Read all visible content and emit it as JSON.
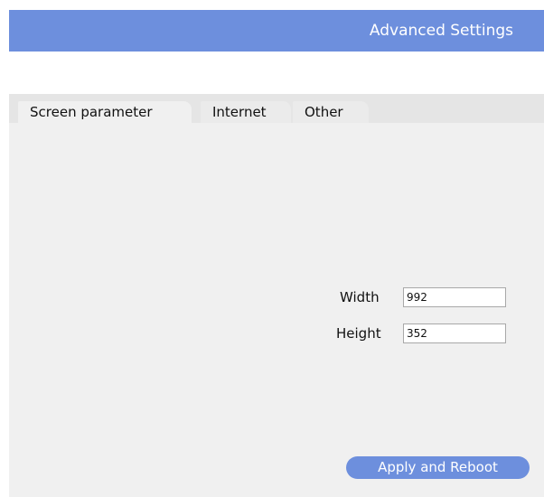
{
  "header": {
    "title": "Advanced Settings"
  },
  "tabs": [
    {
      "label": "Screen parameter",
      "selected": true
    },
    {
      "label": "Internet",
      "selected": false
    },
    {
      "label": "Other",
      "selected": false
    }
  ],
  "screen_parameter": {
    "width": {
      "label": "Width",
      "value": "992"
    },
    "height": {
      "label": "Height",
      "value": "352"
    }
  },
  "actions": {
    "apply_label": "Apply and Reboot"
  },
  "colors": {
    "accent": "#6d8fdd",
    "panel_background": "#f0f0f0",
    "tabbar_background": "#e5e5e5"
  }
}
